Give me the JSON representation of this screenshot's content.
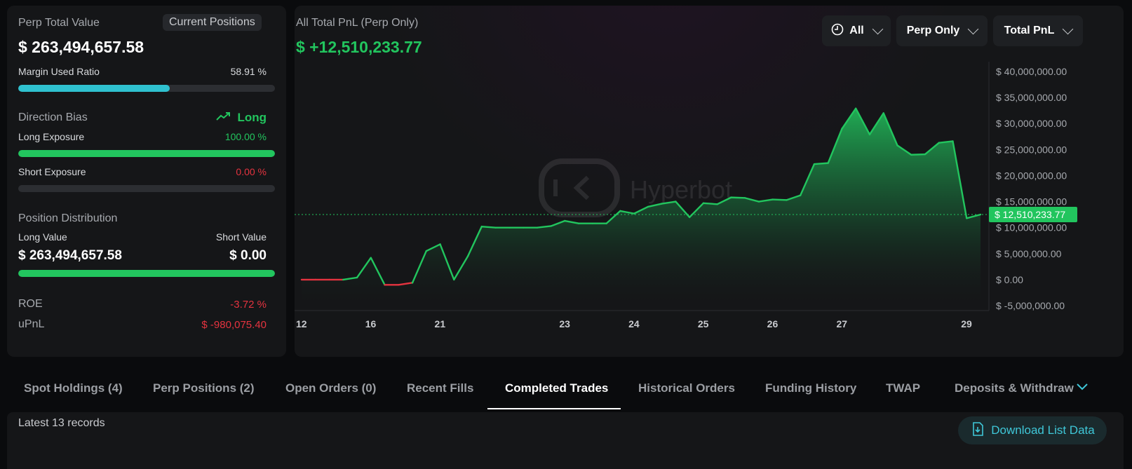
{
  "summary": {
    "perp_total_value_label": "Perp Total Value",
    "current_positions_label": "Current Positions",
    "perp_total_value": "$ 263,494,657.58",
    "margin_used_ratio_label": "Margin Used Ratio",
    "margin_used_ratio": "58.91 %",
    "margin_used_ratio_fraction": 0.5891,
    "direction_bias_label": "Direction Bias",
    "direction_bias": "Long",
    "long_exposure_label": "Long Exposure",
    "long_exposure": "100.00 %",
    "long_exposure_fraction": 1.0,
    "short_exposure_label": "Short Exposure",
    "short_exposure": "0.00 %",
    "short_exposure_fraction": 0.0,
    "position_distribution_label": "Position Distribution",
    "long_value_label": "Long Value",
    "short_value_label": "Short Value",
    "long_value": "$ 263,494,657.58",
    "short_value": "$ 0.00",
    "long_share_fraction": 1.0,
    "roe_label": "ROE",
    "roe": "-3.72 %",
    "upnl_label": "uPnL",
    "upnl": "$ -980,075.40"
  },
  "colors": {
    "accent_cyan": "#2fc1cf",
    "positive_green": "#22c55e",
    "negative_red": "#e5333f",
    "brand_teal": "#3fc7d8"
  },
  "chart_header": {
    "title": "All Total PnL (Perp Only)",
    "value": "$ +12,510,233.77",
    "watermark": "Hyperbot"
  },
  "filters": {
    "range": "All",
    "scope": "Perp Only",
    "metric": "Total PnL"
  },
  "chart_data": {
    "type": "area",
    "title": "All Total PnL (Perp Only)",
    "ylim": [
      -5000000,
      40000000
    ],
    "y_ticks": [
      "$ 40,000,000.00",
      "$ 35,000,000.00",
      "$ 30,000,000.00",
      "$ 25,000,000.00",
      "$ 20,000,000.00",
      "$ 15,000,000.00",
      "$ 10,000,000.00",
      "$ 5,000,000.00",
      "$ 0.00",
      "$ -5,000,000.00"
    ],
    "x_tick_labels": [
      "12",
      "16",
      "21",
      "23",
      "24",
      "25",
      "26",
      "27",
      "29"
    ],
    "current_value_label": "$ 12,510,233.77",
    "current_value": 12510233.77,
    "series": [
      {
        "values": [
          0,
          0,
          0,
          0,
          400000,
          4200000,
          -1000000,
          -1000000,
          -600000,
          5500000,
          6800000,
          0,
          4500000,
          10200000,
          10000000,
          10000000,
          10000000,
          10000000,
          10300000,
          11300000,
          10800000,
          10800000,
          10800000,
          13200000,
          12700000,
          14000000,
          14600000,
          15000000,
          12000000,
          14700000,
          14500000,
          15800000,
          15700000,
          15000000,
          15400000,
          15300000,
          16200000,
          22200000,
          22400000,
          29000000,
          32900000,
          27900000,
          32000000,
          25800000,
          24000000,
          24100000,
          26300000,
          26600000,
          11800000,
          12510233.77
        ]
      }
    ]
  },
  "tabs": [
    "Spot Holdings (4)",
    "Perp Positions (2)",
    "Open Orders (0)",
    "Recent Fills",
    "Completed Trades",
    "Historical Orders",
    "Funding History",
    "TWAP",
    "Deposits & Withdraw"
  ],
  "active_tab": "Completed Trades",
  "records": {
    "label": "Latest 13 records",
    "download_label": "Download List Data"
  }
}
